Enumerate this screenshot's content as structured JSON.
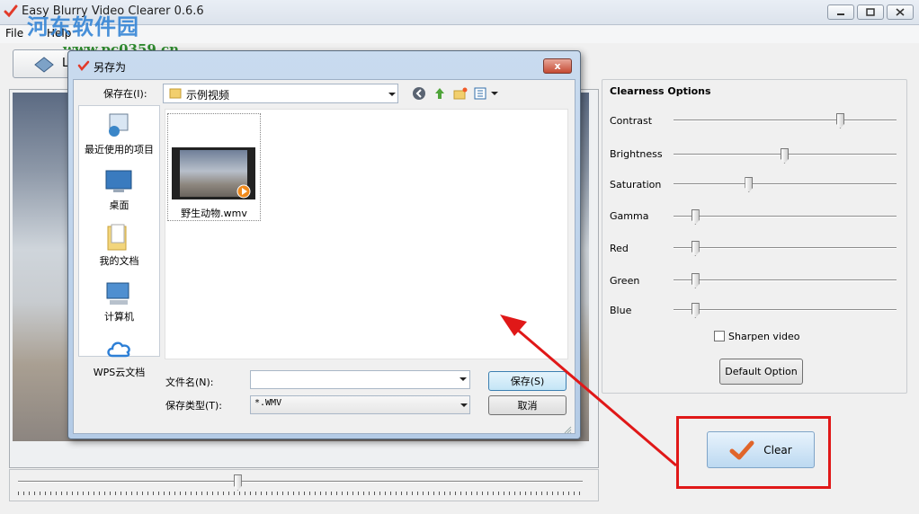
{
  "app": {
    "title": "Easy Blurry Video Clearer 0.6.6",
    "menu": [
      "File",
      "Help"
    ],
    "load_button_label": "L",
    "watermark_text": "河东软件园",
    "watermark_url": "www.pc0359.cn"
  },
  "options": {
    "title": "Clearness Options",
    "sliders": [
      {
        "label": "Contrast",
        "level": 0.75
      },
      {
        "label": "Brightness",
        "level": 0.5
      },
      {
        "label": "Saturation",
        "level": 0.34
      },
      {
        "label": "Gamma",
        "level": 0.1
      },
      {
        "label": "Red",
        "level": 0.1
      },
      {
        "label": "Green",
        "level": 0.1
      },
      {
        "label": "Blue",
        "level": 0.1
      }
    ],
    "sharpen_label": "Sharpen video",
    "sharpen_checked": false,
    "default_button": "Default Option",
    "clear_button": "Clear"
  },
  "timeline": {
    "position": 0.39
  },
  "dialog": {
    "title": "另存为",
    "save_in_label": "保存在(I):",
    "save_in_value": "示例视频",
    "places": [
      "最近使用的项目",
      "桌面",
      "我的文档",
      "计算机",
      "WPS云文档"
    ],
    "file_name_in_list": "野生动物.wmv",
    "file_name_label": "文件名(N):",
    "file_name_value": "",
    "file_type_label": "保存类型(T):",
    "file_type_value": "*.WMV",
    "save_button": "保存(S)",
    "cancel_button": "取消",
    "close_glyph": "x"
  },
  "colors": {
    "annotation": "#e01818",
    "accent": "#2a7fd4"
  }
}
